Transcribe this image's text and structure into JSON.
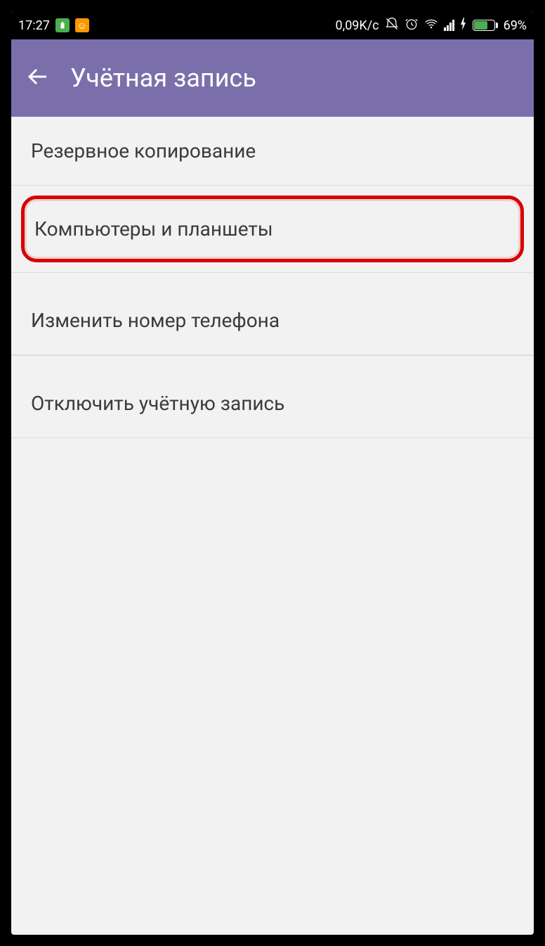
{
  "status_bar": {
    "time": "17:27",
    "network_speed": "0,09K/c",
    "battery_percent": "69%"
  },
  "header": {
    "title": "Учётная запись"
  },
  "menu": {
    "items": [
      {
        "label": "Резервное копирование"
      },
      {
        "label": "Компьютеры и планшеты",
        "highlighted": true
      },
      {
        "label": "Изменить номер телефона"
      },
      {
        "label": "Отключить учётную запись"
      }
    ]
  }
}
